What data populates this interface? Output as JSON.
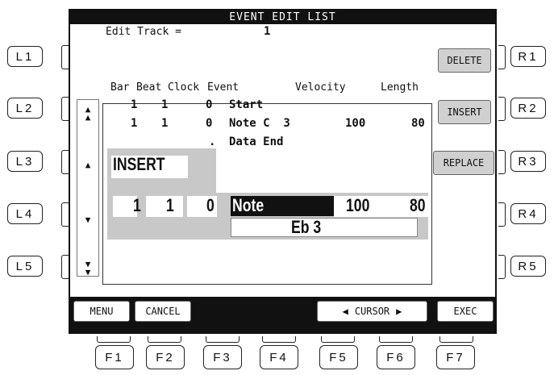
{
  "title": "EVENT EDIT LIST",
  "edit_track": {
    "label": "Edit Track =",
    "value": "1"
  },
  "columns": [
    "Bar",
    "Beat",
    "Clock",
    "Event",
    "Velocity",
    "Length"
  ],
  "rows": [
    {
      "bar": "1",
      "beat": "1",
      "clock": "0",
      "event": "Start",
      "velocity": "",
      "length": ""
    },
    {
      "bar": "1",
      "beat": "1",
      "clock": "0",
      "event": "Note C  3",
      "velocity": "100",
      "length": "80"
    },
    {
      "bar": "",
      "beat": "",
      "clock": ".",
      "event": "Data End",
      "velocity": "",
      "length": ""
    }
  ],
  "insert_panel": {
    "title": "INSERT",
    "bar": "1",
    "beat": "1",
    "clock": "0",
    "event": "Note",
    "velocity": "100",
    "length": "80",
    "note_value": "Eb 3"
  },
  "right_buttons": [
    "DELETE",
    "INSERT",
    "REPLACE"
  ],
  "bottom_buttons": {
    "menu": "MENU",
    "cancel": "CANCEL",
    "cursor": "CURSOR",
    "exec": "EXEC"
  },
  "left_hw": [
    "L1",
    "L2",
    "L3",
    "L4",
    "L5"
  ],
  "right_hw": [
    "R1",
    "R2",
    "R3",
    "R4",
    "R5"
  ],
  "function_hw": [
    "F1",
    "F2",
    "F3",
    "F4",
    "F5",
    "F6",
    "F7"
  ],
  "icons": [
    "double-up-arrow",
    "up-arrow",
    "down-arrow",
    "double-down-arrow",
    "left-triangle",
    "right-triangle"
  ]
}
